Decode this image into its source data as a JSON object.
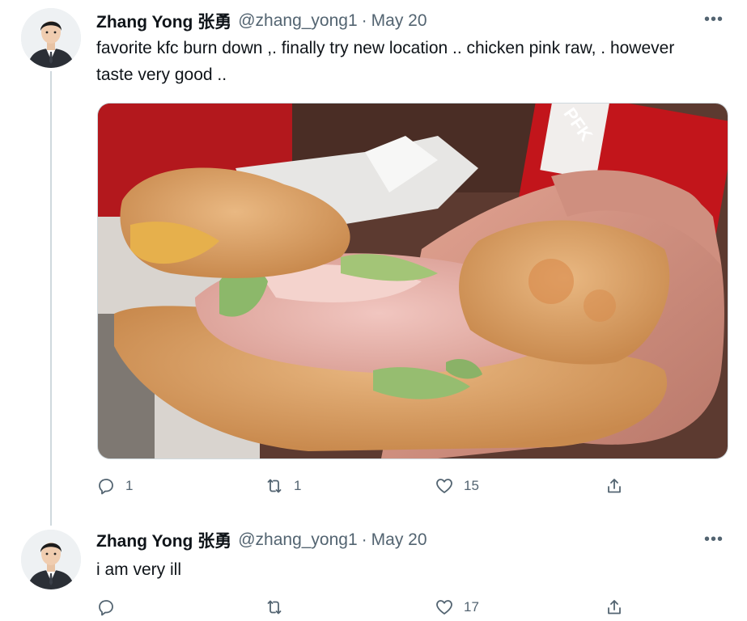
{
  "tweets": [
    {
      "author": {
        "display_name": "Zhang Yong 张勇",
        "handle": "@zhang_yong1",
        "date": "May 20"
      },
      "text": "favorite kfc burn down ,. finally try new location .. chicken  pink raw, . however taste very good ..",
      "media": {
        "type": "photo",
        "box_text": "PFK"
      },
      "actions": {
        "reply_icon": "reply-icon",
        "replies": "1",
        "retweet_icon": "retweet-icon",
        "retweets": "1",
        "like_icon": "heart-icon",
        "likes": "15",
        "share_icon": "share-icon"
      },
      "more_icon": "more-icon"
    },
    {
      "author": {
        "display_name": "Zhang Yong 张勇",
        "handle": "@zhang_yong1",
        "date": "May 20"
      },
      "text": "i am very ill",
      "actions": {
        "reply_icon": "reply-icon",
        "replies": "",
        "retweet_icon": "retweet-icon",
        "retweets": "",
        "like_icon": "heart-icon",
        "likes": "17",
        "share_icon": "share-icon"
      },
      "more_icon": "more-icon"
    }
  ],
  "colors": {
    "text_primary": "#0f1419",
    "text_secondary": "#536471",
    "thread_line": "#cfd9de",
    "box_red": "#c2151b"
  }
}
